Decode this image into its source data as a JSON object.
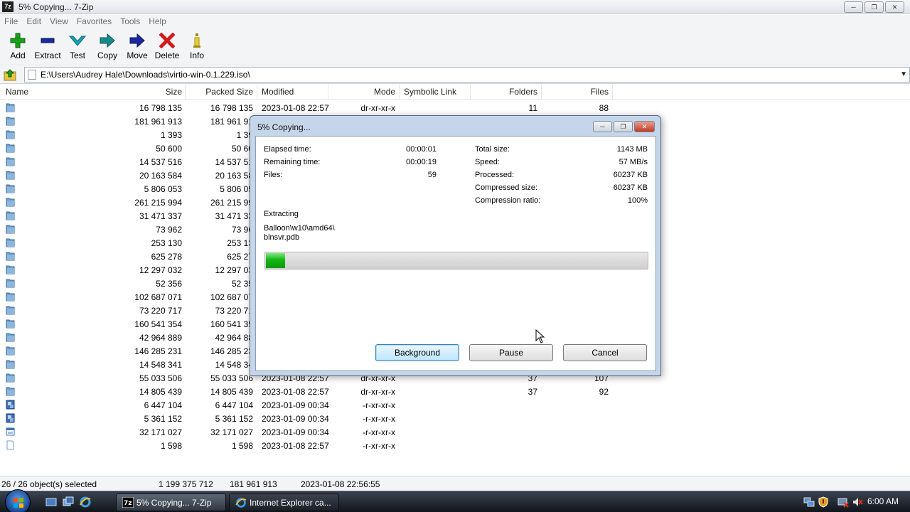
{
  "window": {
    "title": "5% Copying... 7-Zip",
    "app_icon": "7z"
  },
  "menu": [
    "File",
    "Edit",
    "View",
    "Favorites",
    "Tools",
    "Help"
  ],
  "toolbar": [
    {
      "label": "Add",
      "icon": "plus-icon",
      "color": "#1aa11a"
    },
    {
      "label": "Extract",
      "icon": "minus-icon",
      "color": "#1b2a9a"
    },
    {
      "label": "Test",
      "icon": "check-icon",
      "color": "#18a3b5"
    },
    {
      "label": "Copy",
      "icon": "copy-arrow-icon",
      "color": "#178b8b"
    },
    {
      "label": "Move",
      "icon": "move-arrow-icon",
      "color": "#1b2a9a"
    },
    {
      "label": "Delete",
      "icon": "delete-x-icon",
      "color": "#d21a1a"
    },
    {
      "label": "Info",
      "icon": "info-icon",
      "color": "#a08a10"
    }
  ],
  "address": {
    "path": "E:\\Users\\Audrey Hale\\Downloads\\virtio-win-0.1.229.iso\\"
  },
  "columns": [
    "Name",
    "Size",
    "Packed Size",
    "Modified",
    "Mode",
    "Symbolic Link",
    "Folders",
    "Files"
  ],
  "rows": [
    {
      "icon": "folder",
      "size": "16 798 135",
      "packed": "16 798 135",
      "modified": "2023-01-08 22:57",
      "mode": "dr-xr-xr-x",
      "folders": "11",
      "files": "88"
    },
    {
      "icon": "folder",
      "size": "181 961 913",
      "packed": "181 961 91",
      "modified": "",
      "mode": "",
      "folders": "",
      "files": ""
    },
    {
      "icon": "folder",
      "size": "1 393",
      "packed": "1 39",
      "modified": "",
      "mode": "",
      "folders": "",
      "files": ""
    },
    {
      "icon": "folder",
      "size": "50 600",
      "packed": "50 60",
      "modified": "",
      "mode": "",
      "folders": "",
      "files": ""
    },
    {
      "icon": "folder",
      "size": "14 537 516",
      "packed": "14 537 51",
      "modified": "",
      "mode": "",
      "folders": "",
      "files": ""
    },
    {
      "icon": "folder",
      "size": "20 163 584",
      "packed": "20 163 58",
      "modified": "",
      "mode": "",
      "folders": "",
      "files": ""
    },
    {
      "icon": "folder",
      "size": "5 806 053",
      "packed": "5 806 05",
      "modified": "",
      "mode": "",
      "folders": "",
      "files": ""
    },
    {
      "icon": "folder",
      "size": "261 215 994",
      "packed": "261 215 99",
      "modified": "",
      "mode": "",
      "folders": "",
      "files": ""
    },
    {
      "icon": "folder",
      "size": "31 471 337",
      "packed": "31 471 33",
      "modified": "",
      "mode": "",
      "folders": "",
      "files": ""
    },
    {
      "icon": "folder",
      "size": "73 962",
      "packed": "73 96",
      "modified": "",
      "mode": "",
      "folders": "",
      "files": ""
    },
    {
      "icon": "folder",
      "size": "253 130",
      "packed": "253 13",
      "modified": "",
      "mode": "",
      "folders": "",
      "files": ""
    },
    {
      "icon": "folder",
      "size": "625 278",
      "packed": "625 27",
      "modified": "",
      "mode": "",
      "folders": "",
      "files": ""
    },
    {
      "icon": "folder",
      "size": "12 297 032",
      "packed": "12 297 03",
      "modified": "",
      "mode": "",
      "folders": "",
      "files": ""
    },
    {
      "icon": "folder",
      "size": "52 356",
      "packed": "52 35",
      "modified": "",
      "mode": "",
      "folders": "",
      "files": ""
    },
    {
      "icon": "folder",
      "size": "102 687 071",
      "packed": "102 687 07",
      "modified": "",
      "mode": "",
      "folders": "",
      "files": ""
    },
    {
      "icon": "folder",
      "size": "73 220 717",
      "packed": "73 220 71",
      "modified": "",
      "mode": "",
      "folders": "",
      "files": ""
    },
    {
      "icon": "folder",
      "size": "160 541 354",
      "packed": "160 541 35",
      "modified": "",
      "mode": "",
      "folders": "",
      "files": ""
    },
    {
      "icon": "folder",
      "size": "42 964 889",
      "packed": "42 964 88",
      "modified": "",
      "mode": "",
      "folders": "",
      "files": ""
    },
    {
      "icon": "folder",
      "size": "146 285 231",
      "packed": "146 285 23",
      "modified": "",
      "mode": "",
      "folders": "",
      "files": ""
    },
    {
      "icon": "folder",
      "size": "14 548 341",
      "packed": "14 548 34",
      "modified": "",
      "mode": "",
      "folders": "",
      "files": ""
    },
    {
      "icon": "folder",
      "size": "55 033 506",
      "packed": "55 033 506",
      "modified": "2023-01-08 22:57",
      "mode": "dr-xr-xr-x",
      "folders": "37",
      "files": "107"
    },
    {
      "icon": "folder",
      "size": "14 805 439",
      "packed": "14 805 439",
      "modified": "2023-01-08 22:57",
      "mode": "dr-xr-xr-x",
      "folders": "37",
      "files": "92"
    },
    {
      "icon": "exe",
      "size": "6 447 104",
      "packed": "6 447 104",
      "modified": "2023-01-09 00:34",
      "mode": "-r-xr-xr-x",
      "folders": "",
      "files": ""
    },
    {
      "icon": "exe",
      "size": "5 361 152",
      "packed": "5 361 152",
      "modified": "2023-01-09 00:34",
      "mode": "-r-xr-xr-x",
      "folders": "",
      "files": ""
    },
    {
      "icon": "window-file",
      "size": "32 171 027",
      "packed": "32 171 027",
      "modified": "2023-01-09 00:34",
      "mode": "-r-xr-xr-x",
      "folders": "",
      "files": ""
    },
    {
      "icon": "file",
      "size": "1 598",
      "packed": "1 598",
      "modified": "2023-01-08 22:57",
      "mode": "-r-xr-xr-x",
      "folders": "",
      "files": ""
    }
  ],
  "status": {
    "selected": "26 / 26 object(s) selected",
    "total_size": "1 199 375 712",
    "packed_size": "181 961 913",
    "modified": "2023-01-08 22:56:55"
  },
  "dialog": {
    "title": "5% Copying...",
    "elapsed_label": "Elapsed time:",
    "elapsed_value": "00:00:01",
    "remaining_label": "Remaining time:",
    "remaining_value": "00:00:19",
    "files_label": "Files:",
    "files_value": "59",
    "total_label": "Total size:",
    "total_value": "1143 MB",
    "speed_label": "Speed:",
    "speed_value": "57 MB/s",
    "processed_label": "Processed:",
    "processed_value": "60237 KB",
    "compressed_label": "Compressed size:",
    "compressed_value": "60237 KB",
    "ratio_label": "Compression ratio:",
    "ratio_value": "100%",
    "action": "Extracting",
    "current_path": "Balloon\\w10\\amd64\\",
    "current_file": "blnsvr.pdb",
    "progress_percent": 5,
    "btn_background": "Background",
    "btn_pause": "Pause",
    "btn_cancel": "Cancel"
  },
  "taskbar": {
    "tasks": [
      {
        "label": "5% Copying... 7-Zip",
        "active": true
      },
      {
        "label": "Internet Explorer ca...",
        "active": false
      }
    ],
    "clock": "6:00 AM"
  },
  "colors": {
    "progress_green": "#13b513",
    "dialog_frame": "#c6d6ea",
    "close_red": "#c23a22",
    "folder_blue": "#6f9fd0"
  }
}
